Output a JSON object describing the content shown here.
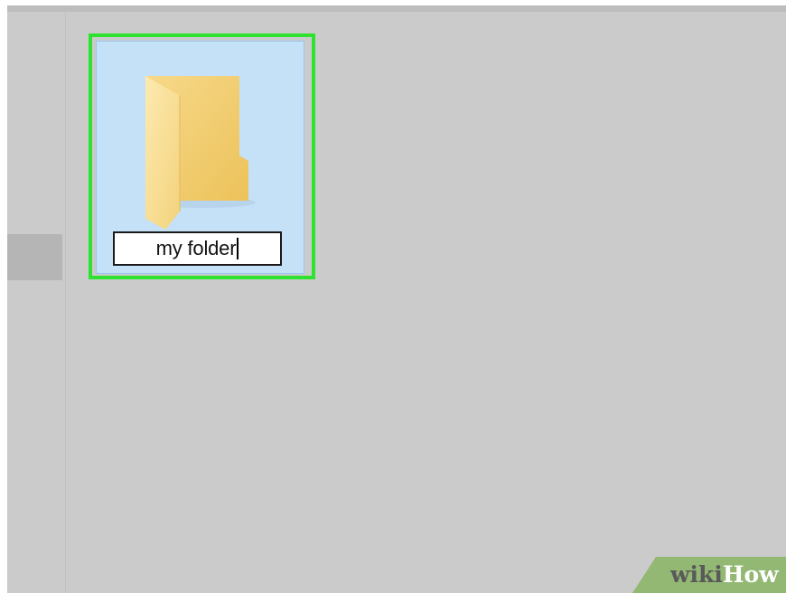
{
  "explorer": {
    "folder": {
      "name": "my folder",
      "state": "renaming"
    }
  },
  "watermark": {
    "part1": "wiki",
    "part2": "How"
  },
  "colors": {
    "highlight_box": "#2fe22f",
    "selection_fill": "#c5e1f8",
    "folder_yellow": "#f5d27a",
    "background": "#cbcbcb",
    "watermark_green": "#93b874"
  },
  "icons": [
    "folder-icon",
    "text-caret"
  ]
}
